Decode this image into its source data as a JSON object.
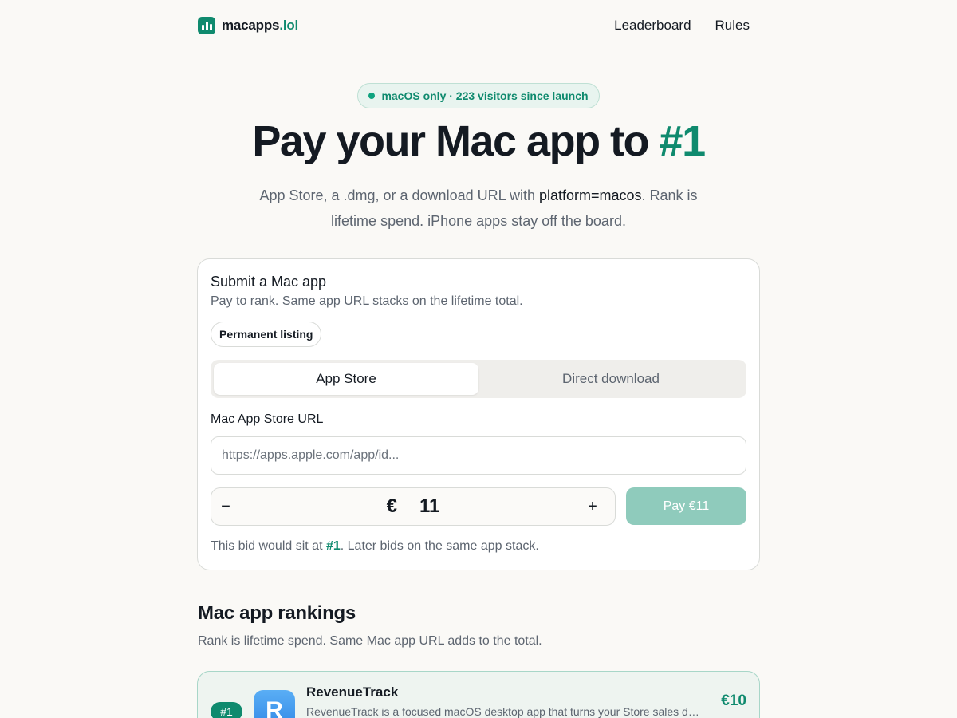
{
  "header": {
    "logo_name": "macapps",
    "logo_tld": ".lol",
    "nav": [
      {
        "label": "Leaderboard"
      },
      {
        "label": "Rules"
      }
    ]
  },
  "hero": {
    "pill": "macOS only · 223 visitors since launch",
    "title_main": "Pay your Mac app to ",
    "title_accent": "#1",
    "sub_before": "App Store, a .dmg, or a download URL with ",
    "sub_code": "platform=macos",
    "sub_after": ". Rank is lifetime spend. iPhone apps stay off the board."
  },
  "submit": {
    "title": "Submit a Mac app",
    "subtitle": "Pay to rank. Same app URL stacks on the lifetime total.",
    "chip": "Permanent listing",
    "tabs": [
      {
        "label": "App Store",
        "active": true
      },
      {
        "label": "Direct download",
        "active": false
      }
    ],
    "url_label": "Mac App Store URL",
    "url_value": "",
    "url_placeholder": "https://apps.apple.com/app/id...",
    "currency": "€",
    "amount": "11",
    "minus": "−",
    "plus": "+",
    "pay_label": "Pay €11",
    "note_before": "This bid would sit at ",
    "note_rank": "#1",
    "note_after": ". Later bids on the same app stack."
  },
  "rankings": {
    "title": "Mac app rankings",
    "subtitle": "Rank is lifetime spend. Same Mac app URL adds to the total.",
    "items": [
      {
        "rank": "#1",
        "icon_letter": "R",
        "name": "RevenueTrack",
        "description": "RevenueTrack is a focused macOS desktop app that turns your Store sales data into clear insights.",
        "total": "€10"
      }
    ]
  },
  "colors": {
    "accent": "#0f8a6e",
    "background": "#faf9f6",
    "pay_disabled": "#8fcbbc"
  }
}
